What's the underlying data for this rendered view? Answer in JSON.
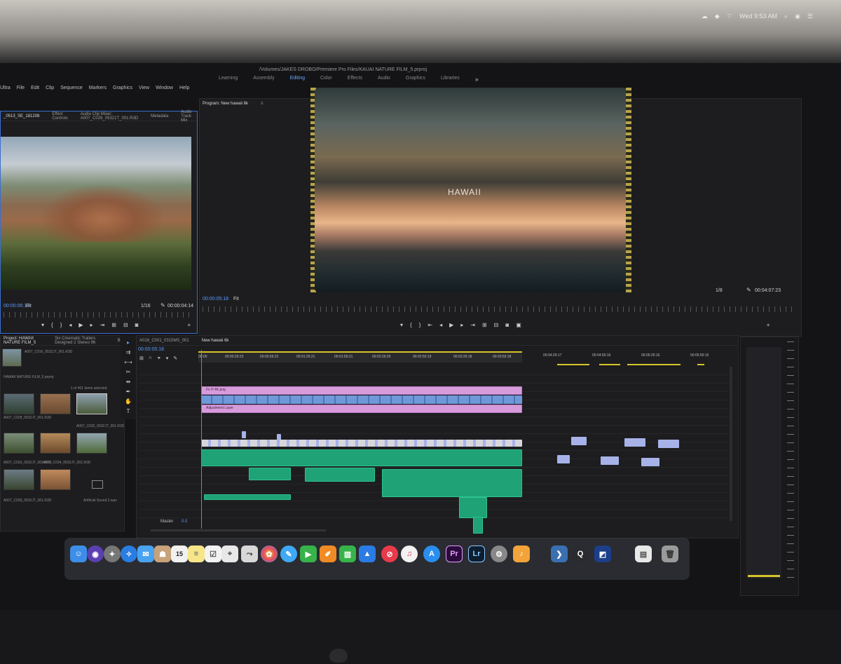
{
  "status_bar": {
    "clock": "Wed 9:53 AM",
    "icons": [
      "creative-cloud-icon",
      "dropbox-icon",
      "wifi-icon",
      "search-icon",
      "siri-icon",
      "notification-center-icon"
    ]
  },
  "menu_bar": {
    "items": [
      "Ultra",
      "File",
      "Edit",
      "Clip",
      "Sequence",
      "Markers",
      "Graphics",
      "View",
      "Window",
      "Help"
    ]
  },
  "window": {
    "path": "/Volumes/JAKES DROBO/Premiere Pro Files/KAUAI NATURE FILM_5.prproj"
  },
  "workspaces": {
    "tabs": [
      "Learning",
      "Assembly",
      "Editing",
      "Color",
      "Effects",
      "Audio",
      "Graphics",
      "Libraries"
    ],
    "active": "Editing",
    "more": "»"
  },
  "source_monitor": {
    "tabs": [
      "_0513_SE_181208",
      "Effect Controls",
      "Audio Clip Mixer: A007_C026_05321T_001.R3D",
      "Metadata",
      "Audio Track Mix"
    ],
    "timecode_in": "00:00:06:13",
    "fit": "Fit",
    "resolution": "1/16",
    "duration": "00:00:04:14"
  },
  "program_monitor": {
    "title": "Program: New hawaii 6k",
    "caption": "HAWAII",
    "timecode": "00:00:05:18",
    "fit": "Fit",
    "resolution": "1/8",
    "duration": "00:04:07:23"
  },
  "project_panel": {
    "tabs": [
      "Project: HAWAII NATURE FILM_5",
      "Six Cinematic Trailers Designed 2 Stereo 96",
      "Bro"
    ],
    "bin_name": "HAWAII NATURE FILM_5.prproj",
    "selection": "1 of 401 items selected",
    "items": [
      "A007_C016_0532JT_001.R3D",
      "A007_C028_0532JT_001.R3D",
      "A007_C032_0532JT_001.R3D",
      "A007_C033_0532JT_001.R3D",
      "A007_C034_0532JT_001.R3D",
      "A007_C035_0532JT_001.R3D",
      "A007_C038_0532JT_001.R3D",
      "A007_C039_0532JT_001.R3D",
      "Artificial Sound 2.wav"
    ]
  },
  "timeline": {
    "tabs": [
      "A018_C001_0315MS_001",
      "New hawaii 6k"
    ],
    "timecode": "00:00:05:18",
    "ruler_labels": [
      "00:00",
      "00:00:29:23",
      "00:00:59:22",
      "00:01:29:21",
      "00:01:59:21",
      "00:02:29:20",
      "00:02:59:19",
      "00:03:29:18",
      "00:03:59:18",
      "00:04:29:17",
      "00:04:59:16",
      "00:05:29:16",
      "00:05:59:15"
    ],
    "clip_labels": {
      "title_clip": "Fx H 4K.png",
      "adjustment_layer": "Adjustment Layer"
    },
    "master_label": "Master",
    "master_value": "0.0"
  },
  "dock": {
    "apps": [
      "finder-icon",
      "siri-icon",
      "launchpad-icon",
      "safari-icon",
      "mail-icon",
      "contacts-icon",
      "calendar-icon",
      "notes-icon",
      "reminders-icon",
      "maps-icon",
      "photos-icon",
      "messages-icon",
      "facetime-icon",
      "pages-icon",
      "numbers-icon",
      "keynote-icon",
      "news-icon",
      "music-icon",
      "app-store-icon",
      "premiere-pro-icon",
      "lightroom-icon",
      "system-preferences-icon",
      "logic-icon",
      "airplay-icon",
      "quicktime-icon",
      "downloads-icon",
      "documents-icon",
      "trash-icon"
    ],
    "calendar_day": "15",
    "premiere_label": "Pr",
    "lightroom_label": "Lr"
  },
  "colors": {
    "accent_blue": "#4a8cff",
    "clip_pink": "#d79bdc",
    "clip_green": "#1fa276",
    "work_area_yellow": "#d6c42a"
  }
}
